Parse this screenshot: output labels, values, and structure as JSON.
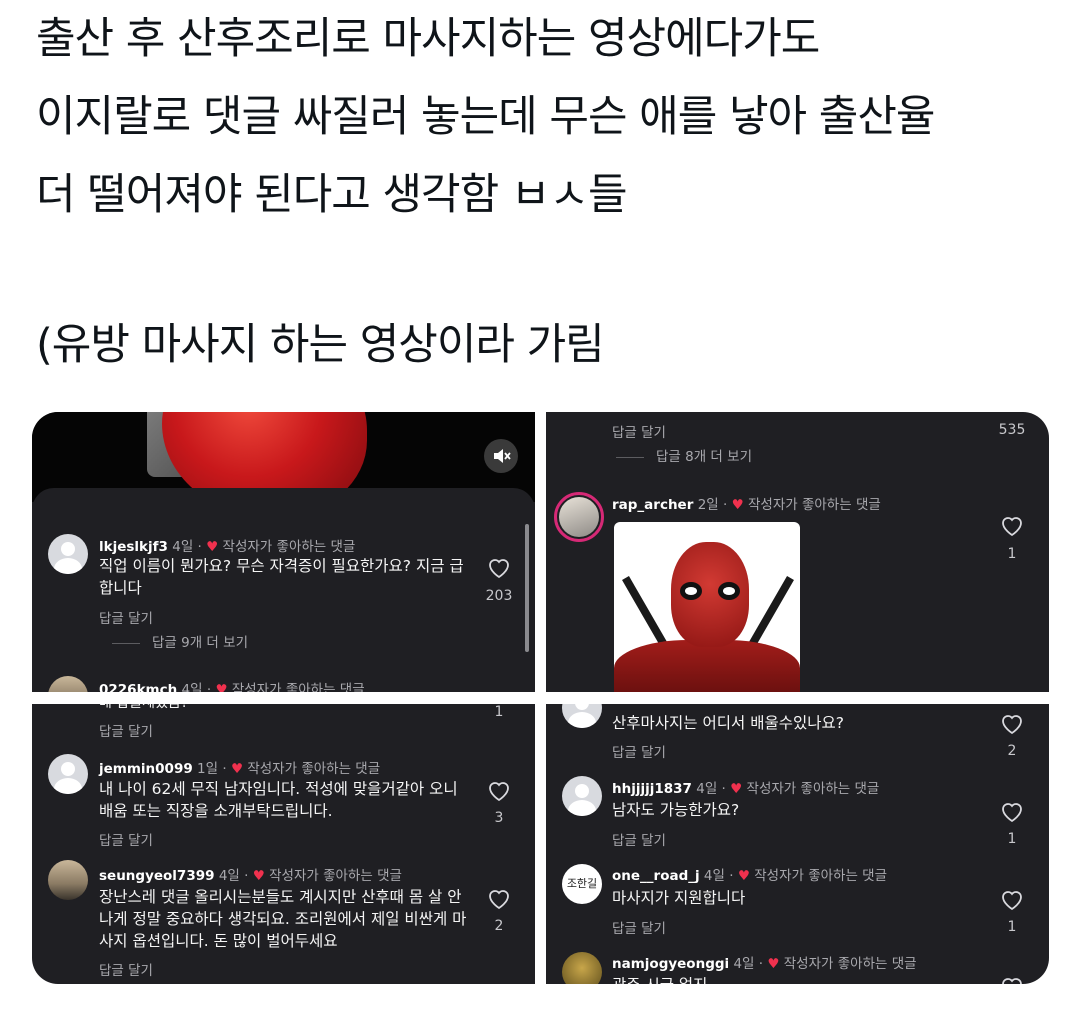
{
  "post": {
    "lines": [
      "출산 후 산후조리로 마사지하는 영상에다가도",
      "이지랄로 댓글 싸질러 놓는데 무슨 애를 낳아 출산율",
      "더 떨어져야 된다고 생각함 ㅂㅅ들",
      "(유방 마사지 하는 영상이라 가림"
    ]
  },
  "panel_top_left": {
    "mute_icon": "speaker-mute-icon",
    "comment1": {
      "username": "lkjeslkjf3",
      "age": "4일",
      "liked_by_author": "작성자가 좋아하는 댓글",
      "text": "직업 이름이 뭔가요? 무슨 자격증이 필요한가요? 지금 급합니다",
      "reply": "답글 달기",
      "likes": "203",
      "view_more": "답글 9개 더 보기"
    },
    "comment2": {
      "username": "0226kmch",
      "age": "4일",
      "liked_by_author": "작성자가 좋아하는 댓글"
    }
  },
  "panel_top_right": {
    "reply_top": "답글 달기",
    "count_top": "535",
    "view_more": "답글 8개 더 보기",
    "comment": {
      "username": "rap_archer",
      "age": "2일",
      "liked_by_author": "작성자가 좋아하는 댓글",
      "likes": "1"
    }
  },
  "panel_bottom_left": {
    "cut_text": "배 답글세겠음?",
    "reply_top": "답글 달기",
    "count_top": "1",
    "comment1": {
      "username": "jemmin0099",
      "age": "1일",
      "liked_by_author": "작성자가 좋아하는 댓글",
      "text": "내 나이 62세 무직 남자임니다. 적성에 맞을거같아 오니 배움 또는 직장을 소개부탁드립니다.",
      "reply": "답글 달기",
      "likes": "3"
    },
    "comment2": {
      "username": "seungyeol7399",
      "age": "4일",
      "liked_by_author": "작성자가 좋아하는 댓글",
      "text": "장난스레 댓글 올리시는분들도 계시지만 산후때 몸 살 안나게 정말 중요하다 생각되요. 조리원에서 제일 비싼게 마사지 옵션입니다. 돈 많이 벌어두세요",
      "reply": "답글 달기",
      "likes": "2"
    }
  },
  "panel_bottom_right": {
    "comment0": {
      "text": "산후마사지는 어디서 배울수있나요?",
      "reply": "답글 달기",
      "likes": "2"
    },
    "comment1": {
      "username": "hhjjjjj1837",
      "age": "4일",
      "liked_by_author": "작성자가 좋아하는 댓글",
      "text": "남자도 가능한가요?",
      "reply": "답글 달기",
      "likes": "1"
    },
    "comment2": {
      "username": "one__road_j",
      "age": "4일",
      "liked_by_author": "작성자가 좋아하는 댓글",
      "avatar_text": "조한길",
      "text": "마사지가 지원합니다",
      "reply": "답글 달기",
      "likes": "1"
    },
    "comment3": {
      "username": "namjogyeonggi",
      "age": "4일",
      "liked_by_author": "작성자가 좋아하는 댓글",
      "cut_text": "광주 시급 얼지"
    }
  },
  "colors": {
    "panel_bg": "#1f1f23",
    "heart_red": "#f0314e",
    "muted_text": "#a8a8ad"
  }
}
